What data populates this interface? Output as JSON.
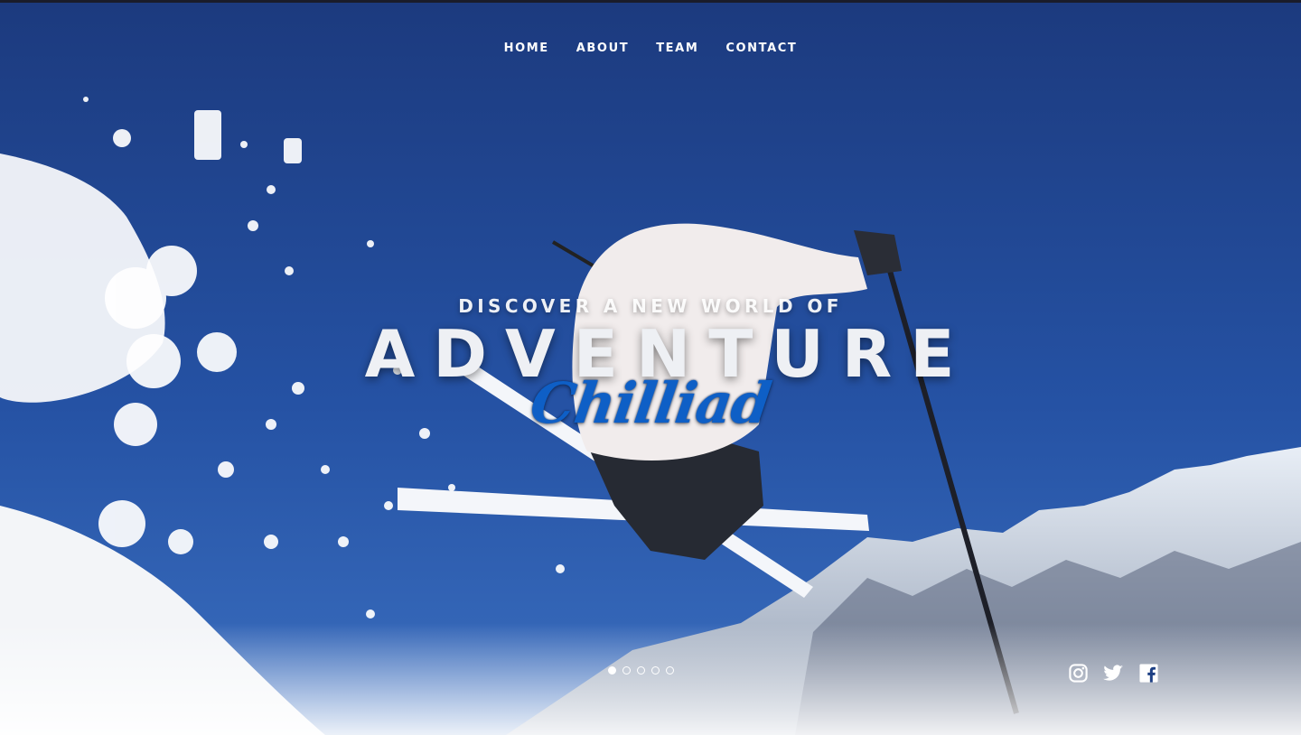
{
  "nav": {
    "items": [
      {
        "label": "HOME"
      },
      {
        "label": "ABOUT"
      },
      {
        "label": "TEAM"
      },
      {
        "label": "CONTACT"
      }
    ]
  },
  "hero": {
    "subheading": "DISCOVER A NEW WORLD OF",
    "title": "ADVENTURE",
    "brand": "Chilliad"
  },
  "slider": {
    "slide_count": 5,
    "active_index": 0
  },
  "social": {
    "icons": [
      "instagram-icon",
      "twitter-icon",
      "facebook-icon"
    ]
  },
  "colors": {
    "sky_top": "#1c3a7e",
    "sky_bottom": "#2f63b8",
    "brand_blue": "#0e5fc6",
    "nav_text": "#ffffff"
  }
}
